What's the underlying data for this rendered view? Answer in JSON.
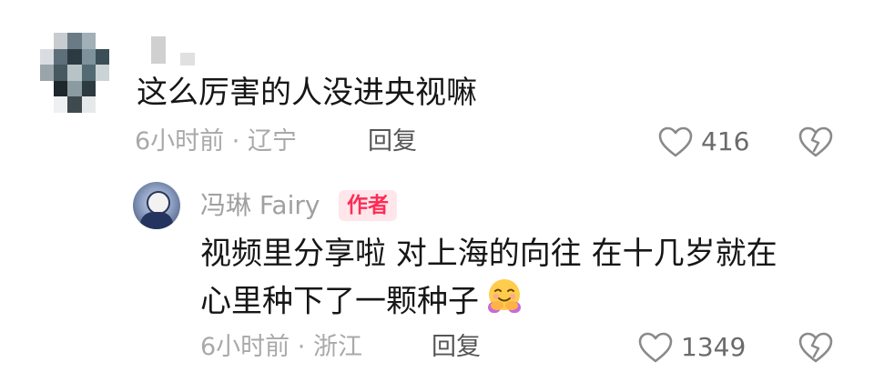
{
  "comment": {
    "text": "这么厉害的人没进央视嘛",
    "time": "6小时前",
    "separator": "·",
    "location": "辽宁",
    "reply_label": "回复",
    "like_count": "416"
  },
  "author_reply": {
    "name": "冯琳 Fairy",
    "badge": "作者",
    "text_line1": "视频里分享啦 对上海的向往 在十几岁就在",
    "text_line2": "心里种下了一颗种子",
    "emoji": "hugging-face-icon",
    "time": "6小时前",
    "separator": "·",
    "location": "浙江",
    "reply_label": "回复",
    "like_count": "1349"
  },
  "colors": {
    "text": "#161616",
    "meta": "#a9a9a9",
    "badge_bg": "#ffe6ea",
    "badge_text": "#fe2c55"
  }
}
